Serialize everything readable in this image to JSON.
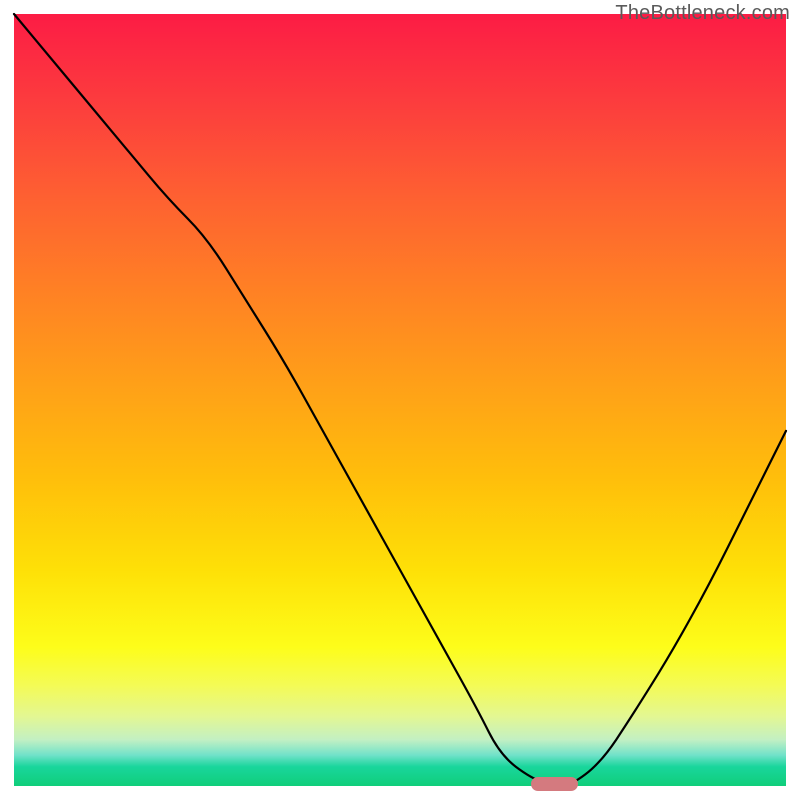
{
  "watermark": "TheBottleneck.com",
  "colors": {
    "curve_stroke": "#000000",
    "marker_fill": "#d47a7f"
  },
  "chart_data": {
    "type": "line",
    "title": "",
    "xlabel": "",
    "ylabel": "",
    "xlim": [
      0,
      100
    ],
    "ylim": [
      0,
      100
    ],
    "series": [
      {
        "name": "bottleneck-curve",
        "x": [
          0,
          5,
          10,
          15,
          20,
          25,
          30,
          35,
          40,
          45,
          50,
          55,
          60,
          63,
          67,
          70,
          72,
          76,
          80,
          85,
          90,
          95,
          100
        ],
        "y": [
          100,
          94,
          88,
          82,
          76,
          71,
          63,
          55,
          46,
          37,
          28,
          19,
          10,
          4,
          1,
          0,
          0,
          3,
          9,
          17,
          26,
          36,
          46
        ]
      }
    ],
    "marker": {
      "x": 70,
      "y": 0,
      "width_pct": 6
    },
    "annotations": []
  }
}
